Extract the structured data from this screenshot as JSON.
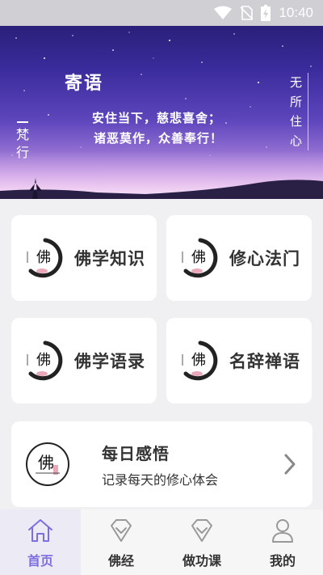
{
  "status_bar": {
    "time": "10:40"
  },
  "banner": {
    "title": "寄语",
    "line1": "安住当下，慈悲喜舍；",
    "line2": "诸恶莫作，众善奉行！",
    "vertical_left": "梵行",
    "vertical_right": "无所住心"
  },
  "cards": [
    {
      "label": "佛学知识"
    },
    {
      "label": "修心法门"
    },
    {
      "label": "佛学语录"
    },
    {
      "label": "名辞禅语"
    }
  ],
  "daily": {
    "title": "每日感悟",
    "subtitle": "记录每天的修心体会"
  },
  "nav": [
    {
      "label": "首页",
      "icon": "home-icon",
      "active": true
    },
    {
      "label": "佛经",
      "icon": "gem-icon",
      "active": false
    },
    {
      "label": "做功课",
      "icon": "gem-icon",
      "active": false
    },
    {
      "label": "我的",
      "icon": "person-icon",
      "active": false
    }
  ],
  "colors": {
    "accent": "#7b6ee0",
    "card": "#ffffff",
    "background": "#f0eff2"
  }
}
